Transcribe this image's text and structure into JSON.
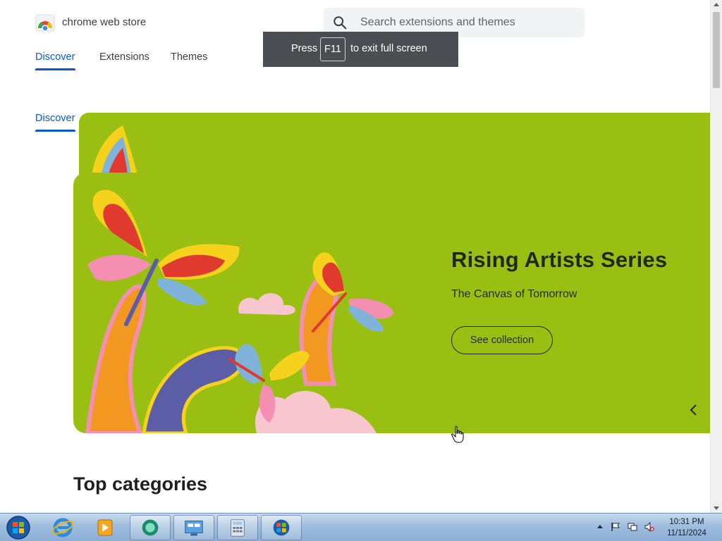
{
  "header": {
    "brand": "chrome web store",
    "search_placeholder": "Search extensions and themes"
  },
  "nav": {
    "tabs": [
      {
        "label": "Discover",
        "active": true
      },
      {
        "label": "Extensions",
        "active": false
      },
      {
        "label": "Themes",
        "active": false
      }
    ],
    "secondary_tab": "Discover"
  },
  "fullscreen_toast": {
    "before": "Press",
    "key": "F11",
    "after": "to exit full screen"
  },
  "hero": {
    "title": "Rising Artists Series",
    "subtitle": "The Canvas of Tomorrow",
    "button": "See collection",
    "background": "#9abf13"
  },
  "sections": {
    "top_categories": "Top categories"
  },
  "taskbar": {
    "pinned": [
      "start-orb-icon",
      "internet-explorer-icon",
      "media-player-icon",
      "messenger-icon",
      "remote-desktop-icon",
      "calculator-icon",
      "chrome-windows-icon"
    ],
    "time": "10:31 PM",
    "date": "11/11/2024"
  },
  "colors": {
    "accent": "#0b57d0",
    "hero_bg": "#9abf13",
    "taskbar": "#9fbddd"
  }
}
